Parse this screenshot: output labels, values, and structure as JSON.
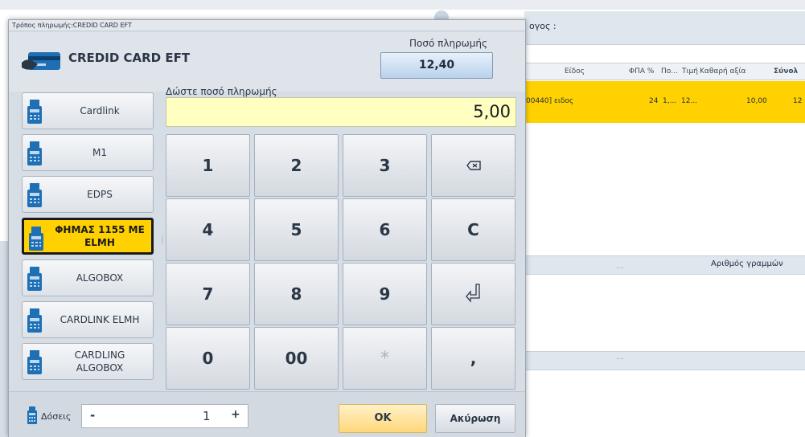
{
  "dialog": {
    "title": "Τρόπος πληρωμής:CREDID CARD EFT",
    "header_title": "CREDID CARD EFT",
    "amount_label": "Ποσό πληρωμής",
    "amount_value": "12,40",
    "enter_amount_label": "Δώστε ποσό πληρωμής",
    "entered_amount": "5,00"
  },
  "payment_methods": [
    {
      "label": "Cardlink",
      "active": false
    },
    {
      "label": "M1",
      "active": false
    },
    {
      "label": "EDPS",
      "active": false
    },
    {
      "label": "ΦΗΜΑΣ 1155 ΜΕ ELMH",
      "active": true
    },
    {
      "label": "ALGOBOX",
      "active": false
    },
    {
      "label": "CARDLINK ELMH",
      "active": false
    },
    {
      "label": "CARDLING ALGOBOX",
      "active": false
    }
  ],
  "keypad": {
    "keys": [
      "1",
      "2",
      "3",
      "⌫",
      "4",
      "5",
      "6",
      "C",
      "7",
      "8",
      "9",
      "↲",
      "0",
      "00",
      "*",
      ","
    ]
  },
  "footer": {
    "doses_label": "Δόσεις",
    "doses_minus": "-",
    "doses_value": "1",
    "doses_plus": "+",
    "ok_label": "OK",
    "cancel_label": "Ακύρωση"
  },
  "background": {
    "customer_label": "ογος :",
    "columns": [
      "Είδος",
      "ΦΠΑ %",
      "Πο...",
      "Τιμή",
      "Καθαρή αξία",
      "Σύνολ"
    ],
    "row": {
      "item": "00440] ειδος",
      "vat": "24",
      "qty": "1,...",
      "price": "12...",
      "net": "10,00",
      "total": "12"
    },
    "lines_label": "Αριθμός γραμμών",
    "dots": "...."
  },
  "colors": {
    "accent_yellow": "#ffd100",
    "input_bg": "#ffffc2",
    "ok_bg": "#ffd77a"
  }
}
